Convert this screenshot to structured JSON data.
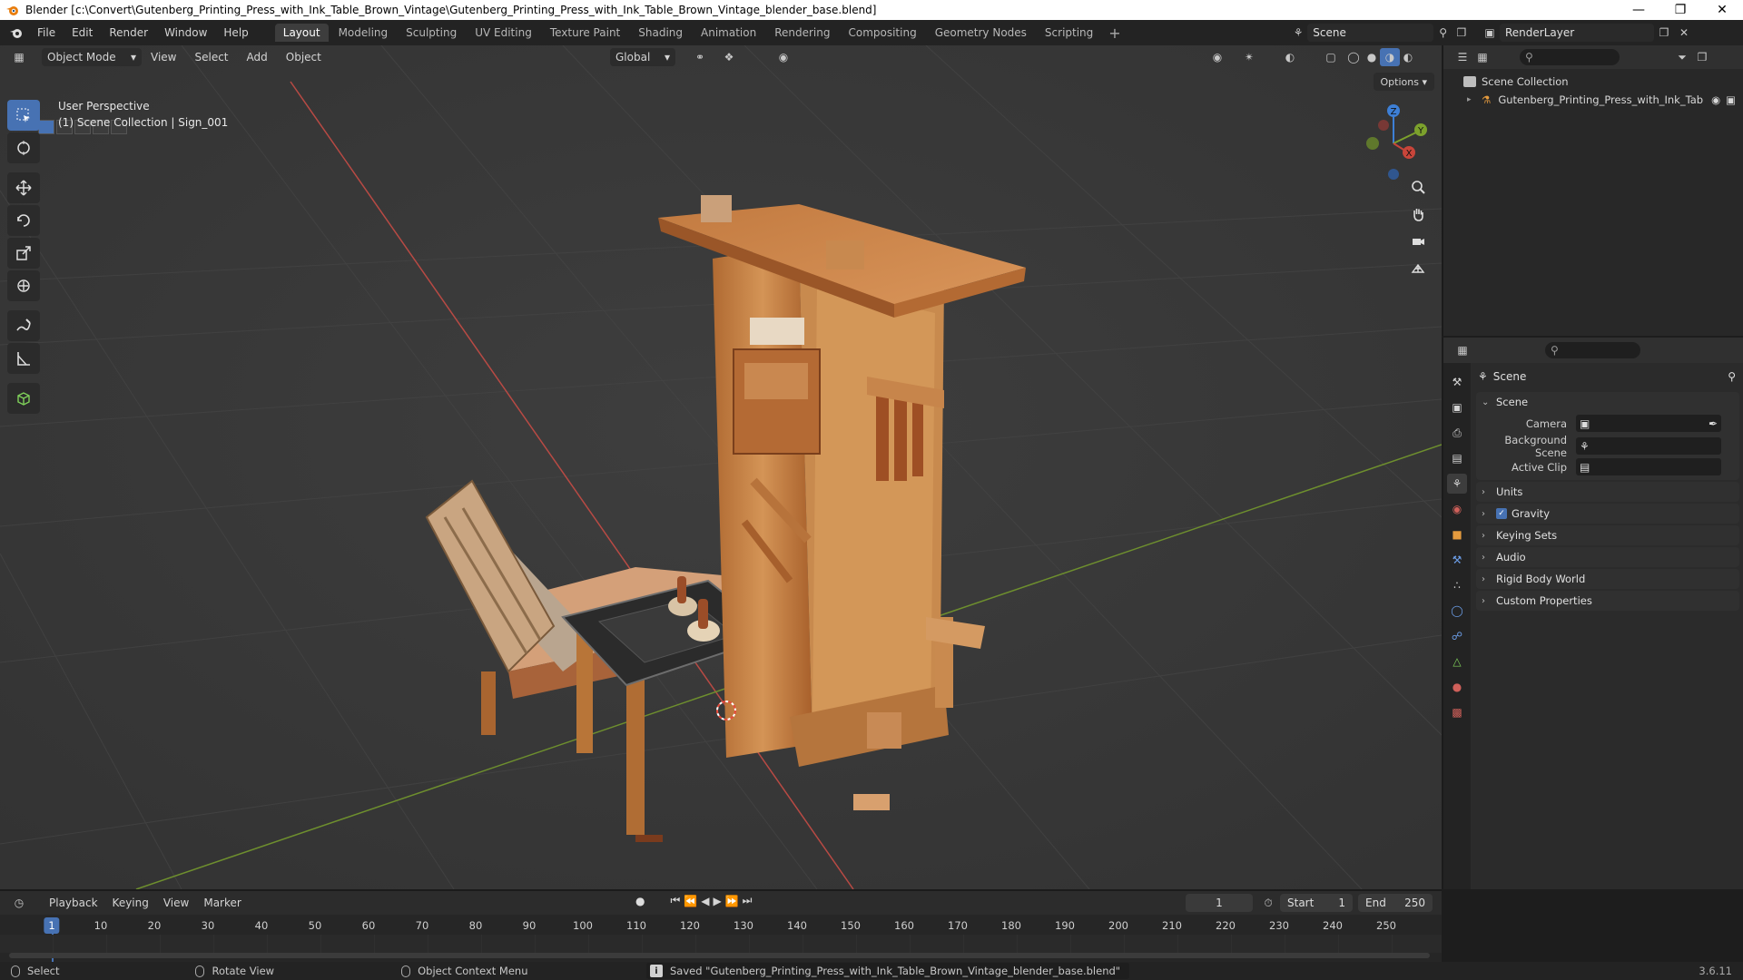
{
  "window": {
    "title": "Blender [c:\\Convert\\Gutenberg_Printing_Press_with_Ink_Table_Brown_Vintage\\Gutenberg_Printing_Press_with_Ink_Table_Brown_Vintage_blender_base.blend]"
  },
  "menu": [
    "File",
    "Edit",
    "Render",
    "Window",
    "Help"
  ],
  "workspaces": [
    {
      "label": "Layout",
      "active": true
    },
    {
      "label": "Modeling"
    },
    {
      "label": "Sculpting"
    },
    {
      "label": "UV Editing"
    },
    {
      "label": "Texture Paint"
    },
    {
      "label": "Shading"
    },
    {
      "label": "Animation"
    },
    {
      "label": "Rendering"
    },
    {
      "label": "Compositing"
    },
    {
      "label": "Geometry Nodes"
    },
    {
      "label": "Scripting"
    }
  ],
  "scene_selector": {
    "value": "Scene"
  },
  "render_layer": {
    "value": "RenderLayer"
  },
  "viewport": {
    "mode": "Object Mode",
    "menus": [
      "View",
      "Select",
      "Add",
      "Object"
    ],
    "orientation": "Global",
    "options_label": "Options",
    "perspective": "User Perspective",
    "context": "(1) Scene Collection | Sign_001"
  },
  "gizmo": {
    "z": "Z",
    "y": "Y",
    "x": "X"
  },
  "outliner": {
    "root": "Scene Collection",
    "items": [
      "Gutenberg_Printing_Press_with_Ink_Tab"
    ]
  },
  "properties": {
    "context": "Scene",
    "scene_panel": {
      "title": "Scene",
      "rows": [
        {
          "label": "Camera",
          "value": ""
        },
        {
          "label": "Background Scene",
          "value": ""
        },
        {
          "label": "Active Clip",
          "value": ""
        }
      ]
    },
    "panels": [
      "Units",
      "Gravity",
      "Keying Sets",
      "Audio",
      "Rigid Body World",
      "Custom Properties"
    ],
    "gravity_checked": true
  },
  "timeline": {
    "menus": [
      "Playback",
      "Keying",
      "View",
      "Marker"
    ],
    "current_frame": "1",
    "start_label": "Start",
    "start": "1",
    "end_label": "End",
    "end": "250",
    "ticks": [
      "10",
      "20",
      "30",
      "40",
      "50",
      "60",
      "70",
      "80",
      "90",
      "100",
      "110",
      "120",
      "130",
      "140",
      "150",
      "160",
      "170",
      "180",
      "190",
      "200",
      "210",
      "220",
      "230",
      "240",
      "250"
    ],
    "ruler_current": "1"
  },
  "status": {
    "select": "Select",
    "rotate": "Rotate View",
    "context_menu": "Object Context Menu",
    "message": "Saved \"Gutenberg_Printing_Press_with_Ink_Table_Brown_Vintage_blender_base.blend\"",
    "version": "3.6.11"
  },
  "colors": {
    "accent": "#4772b3",
    "x_axis": "#c8453a",
    "y_axis": "#7ca12c",
    "z_axis": "#3d7fd6",
    "wood": "#c68447"
  }
}
